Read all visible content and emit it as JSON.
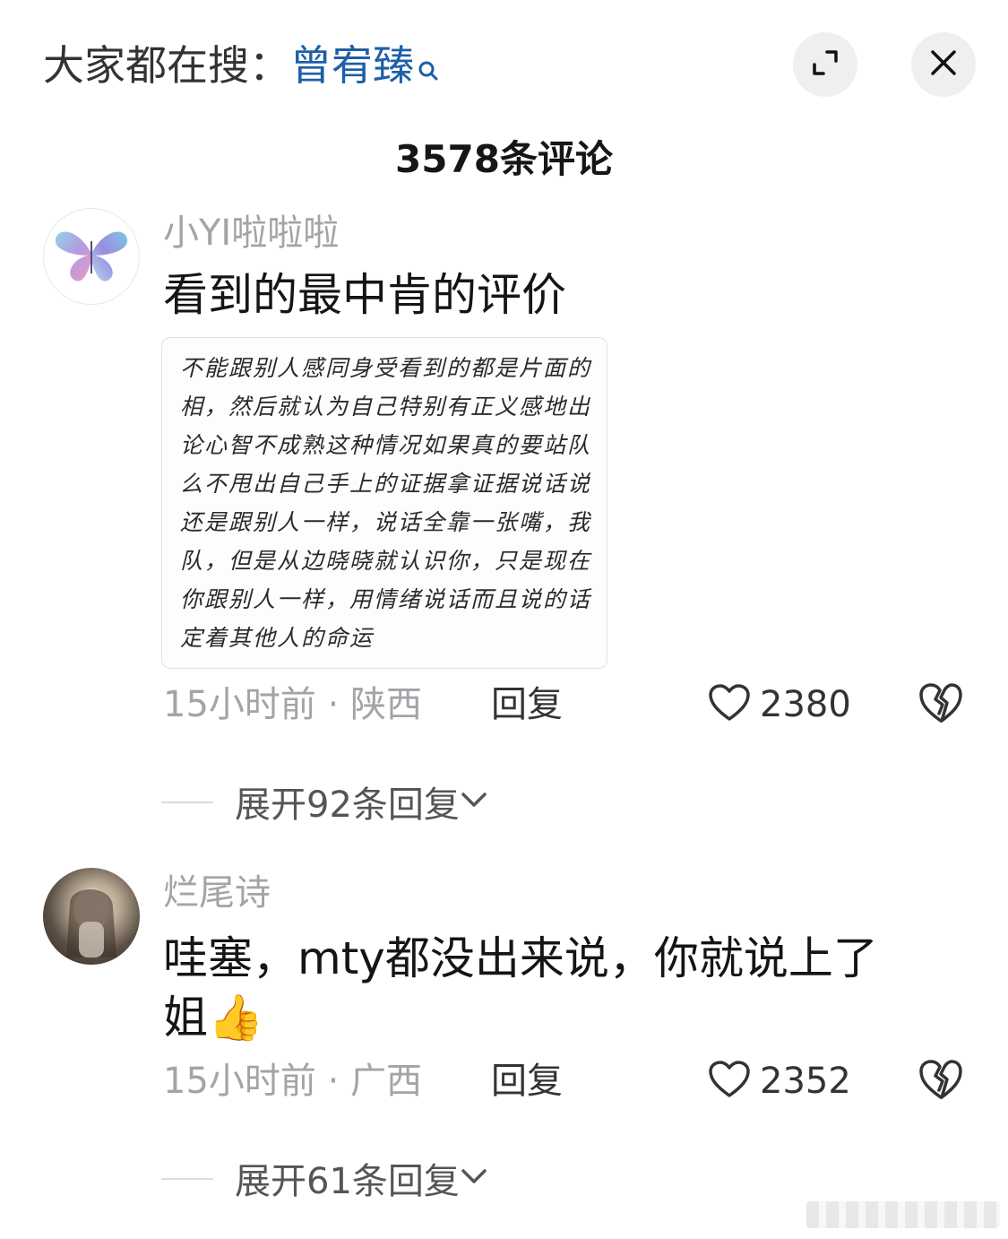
{
  "header": {
    "search_label": "大家都在搜：",
    "search_keyword": "曾宥臻"
  },
  "comment_count": "3578条评论",
  "comments": [
    {
      "username": "小YI啦啦啦",
      "text": "看到的最中肯的评价",
      "image_lines": [
        "不能跟别人感同身受看到的都是片面的",
        "相，然后就认为自己特别有正义感地出",
        "论心智不成熟这种情况如果真的要站队",
        "么不甩出自己手上的证据拿证据说话说",
        "还是跟别人一样，说话全靠一张嘴，我",
        "队，但是从边晓晓就认识你，只是现在",
        "你跟别人一样，用情绪说话而且说的话",
        "定着其他人的命运"
      ],
      "time_location": "15小时前 · 陕西",
      "reply_label": "回复",
      "likes": "2380",
      "expand_label": "展开92条回复"
    },
    {
      "username": "烂尾诗",
      "text_line1": "哇塞，mty都没出来说，你就说上了",
      "text_line2": "姐👍",
      "time_location": "15小时前 · 广西",
      "reply_label": "回复",
      "likes": "2352",
      "expand_label": "展开61条回复"
    }
  ],
  "colors": {
    "keyword": "#1d5fa8",
    "muted": "#a3a3a8",
    "button_bg": "#efeff1"
  }
}
